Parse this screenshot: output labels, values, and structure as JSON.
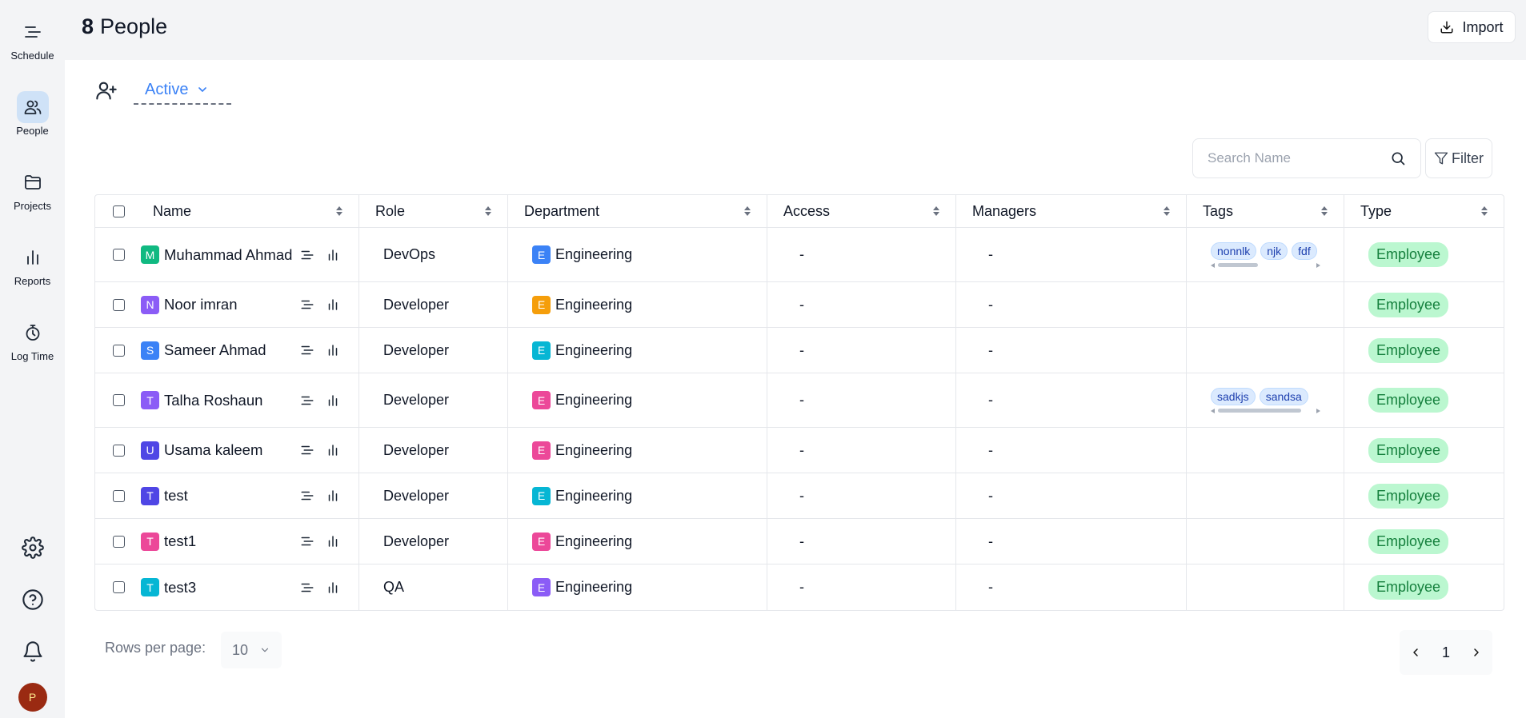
{
  "sidebar": {
    "items": [
      {
        "label": "Schedule",
        "icon": "schedule-icon"
      },
      {
        "label": "People",
        "icon": "people-icon",
        "active": true
      },
      {
        "label": "Projects",
        "icon": "folder-icon"
      },
      {
        "label": "Reports",
        "icon": "bar-chart-icon"
      },
      {
        "label": "Log Time",
        "icon": "stopwatch-icon"
      }
    ],
    "avatar_initial": "P"
  },
  "header": {
    "count": "8",
    "title": "People",
    "import_label": "Import"
  },
  "toolbar": {
    "status": "Active",
    "search_placeholder": "Search Name",
    "filter_label": "Filter"
  },
  "table": {
    "columns": [
      "Name",
      "Role",
      "Department",
      "Access",
      "Managers",
      "Tags",
      "Type"
    ],
    "rows": [
      {
        "initial": "M",
        "initial_color": "#10b981",
        "name": "Muhammad Ahmad",
        "role": "DevOps",
        "dept_initial": "E",
        "dept_color": "#3b82f6",
        "department": "Engineering",
        "access": "-",
        "managers": "-",
        "tags": [
          "nonnlk",
          "njk",
          "fdf"
        ],
        "type": "Employee"
      },
      {
        "initial": "N",
        "initial_color": "#8b5cf6",
        "name": "Noor imran",
        "role": "Developer",
        "dept_initial": "E",
        "dept_color": "#f59e0b",
        "department": "Engineering",
        "access": "-",
        "managers": "-",
        "tags": [],
        "type": "Employee"
      },
      {
        "initial": "S",
        "initial_color": "#3b82f6",
        "name": "Sameer Ahmad",
        "role": "Developer",
        "dept_initial": "E",
        "dept_color": "#06b6d4",
        "department": "Engineering",
        "access": "-",
        "managers": "-",
        "tags": [],
        "type": "Employee"
      },
      {
        "initial": "T",
        "initial_color": "#8b5cf6",
        "name": "Talha Roshaun",
        "role": "Developer",
        "dept_initial": "E",
        "dept_color": "#ec4899",
        "department": "Engineering",
        "access": "-",
        "managers": "-",
        "tags": [
          "sadkjs",
          "sandsa"
        ],
        "type": "Employee"
      },
      {
        "initial": "U",
        "initial_color": "#4f46e5",
        "name": "Usama kaleem",
        "role": "Developer",
        "dept_initial": "E",
        "dept_color": "#ec4899",
        "department": "Engineering",
        "access": "-",
        "managers": "-",
        "tags": [],
        "type": "Employee"
      },
      {
        "initial": "T",
        "initial_color": "#4f46e5",
        "name": "test",
        "role": "Developer",
        "dept_initial": "E",
        "dept_color": "#06b6d4",
        "department": "Engineering",
        "access": "-",
        "managers": "-",
        "tags": [],
        "type": "Employee"
      },
      {
        "initial": "T",
        "initial_color": "#ec4899",
        "name": "test1",
        "role": "Developer",
        "dept_initial": "E",
        "dept_color": "#ec4899",
        "department": "Engineering",
        "access": "-",
        "managers": "-",
        "tags": [],
        "type": "Employee"
      },
      {
        "initial": "T",
        "initial_color": "#06b6d4",
        "name": "test3",
        "role": "QA",
        "dept_initial": "E",
        "dept_color": "#8b5cf6",
        "department": "Engineering",
        "access": "-",
        "managers": "-",
        "tags": [],
        "type": "Employee"
      }
    ]
  },
  "pagination": {
    "rows_label": "Rows per page:",
    "rows_value": "10",
    "page": "1"
  }
}
